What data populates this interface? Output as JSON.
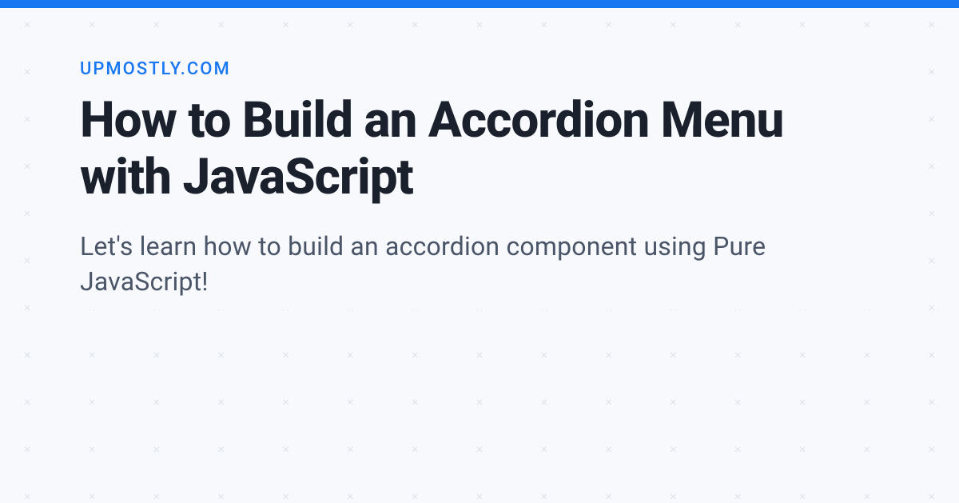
{
  "site_name": "UPMOSTLY.COM",
  "title": "How to Build an Accordion Menu with JavaScript",
  "description": "Let's learn how to build an accordion component using Pure JavaScript!",
  "colors": {
    "accent": "#1977f2",
    "background": "#f7f9fc",
    "heading": "#1a202c",
    "body": "#4a5568",
    "pattern": "#d8dee8"
  }
}
